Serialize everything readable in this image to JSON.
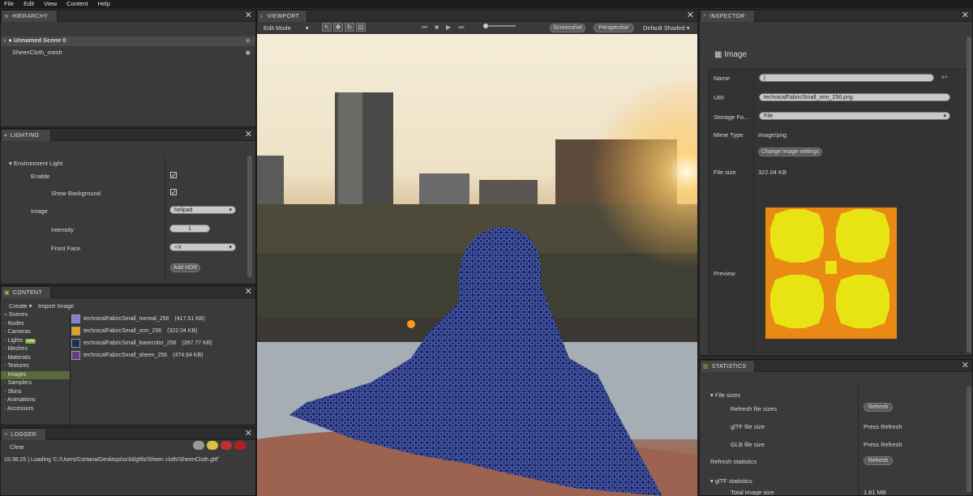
{
  "menu": [
    "File",
    "Edit",
    "View",
    "Content",
    "Help"
  ],
  "hierarchy": {
    "title": "HIERARCHY",
    "items": [
      {
        "label": "Unnamed Scene 0",
        "prefix": "●"
      },
      {
        "label": "SheenCloth_mesh",
        "prefix": ""
      }
    ]
  },
  "lighting": {
    "title": "LIGHTING",
    "section": "Environment Light",
    "enable_label": "Enable",
    "show_bg_label": "Show Background",
    "image_label": "Image",
    "image_value": "helipad",
    "intensity_label": "Intensity",
    "intensity_value": "1",
    "front_face_label": "Front Face",
    "front_face_value": "+X",
    "add_hdr": "Add HDR"
  },
  "content": {
    "title": "CONTENT",
    "create": "Create",
    "import": "Import Image",
    "categories": [
      "Scenes",
      "Nodes",
      "Cameras",
      "Lights",
      "Meshes",
      "Materials",
      "Textures",
      "Images",
      "Samplers",
      "Skins",
      "Animations",
      "Accessors"
    ],
    "lights_badge": "new",
    "selected": "Images",
    "files": [
      {
        "name": "technicalFabricSmall_normal_256",
        "size": "(417.51 KB)",
        "color": "#7f7fd8"
      },
      {
        "name": "technicalFabricSmall_orm_256",
        "size": "(322.04 KB)",
        "color": "#e8a414"
      },
      {
        "name": "technicalFabricSmall_basecolor_256",
        "size": "(397.77 KB)",
        "color": "#1e2e4e"
      },
      {
        "name": "technicalFabricSmall_sheen_256",
        "size": "(474.64 KB)",
        "color": "#6a3a8a"
      }
    ]
  },
  "logger": {
    "title": "LOGGER",
    "clear": "Clear",
    "line": "15:38:25 | Loading 'C:/Users/Cortana/Desktop/ux3d/gltfs/Sheen cloth/SheenCloth.gltf'"
  },
  "viewport": {
    "title": "VIEWPORT",
    "mode": "Edit Mode",
    "screenshot": "Screenshot",
    "perspective": "Perspective",
    "shading": "Default Shaded"
  },
  "inspector": {
    "title": "INSPECTOR",
    "heading": "Image",
    "name_label": "Name",
    "name_value": "|",
    "uri_label": "URI",
    "uri_value": "technicalFabricSmall_orm_256.png",
    "storage_label": "Storage Fo...",
    "storage_value": "File",
    "mime_label": "Mime Type",
    "mime_value": "image/png",
    "change_btn": "Change image settings",
    "size_label": "File size",
    "size_value": "322.04 KB",
    "preview_label": "Preview"
  },
  "statistics": {
    "title": "STATISTICS",
    "file_sizes": "File sizes",
    "refresh_sizes": "Refresh file sizes",
    "refresh": "Refresh",
    "gltf_size": "glTF file size",
    "glb_size": "GLB file size",
    "press": "Press Refresh",
    "refresh_stats": "Refresh statistics",
    "gltf_stats": "glTF statistics",
    "total_image": "Total image size",
    "total_value": "1.61 MB"
  }
}
